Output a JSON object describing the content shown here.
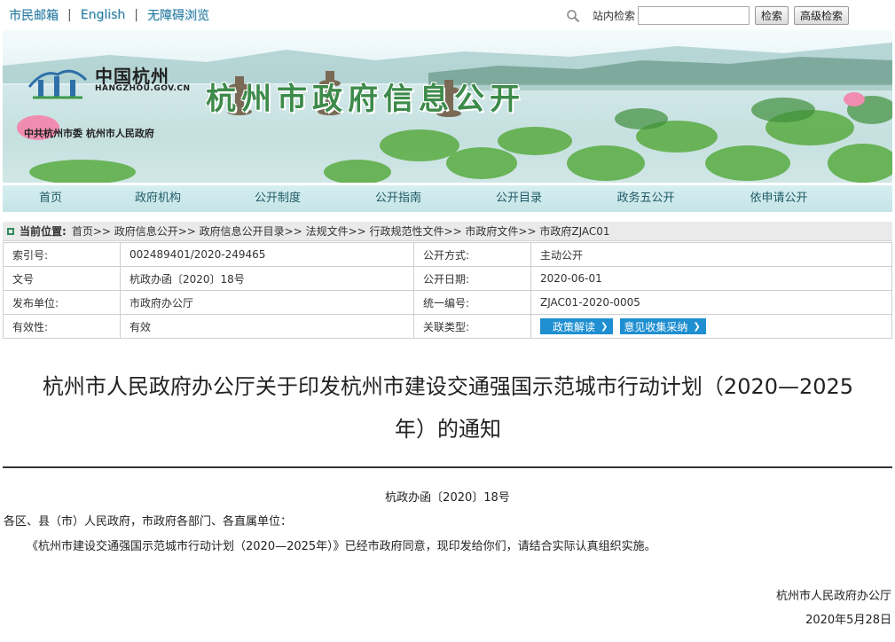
{
  "topbar": {
    "mailbox": "市民邮箱",
    "sep": "|",
    "english": "English",
    "accessible": "无障碍浏览",
    "search_label": "站内检索",
    "search_value": "",
    "search_button": "检索",
    "advanced_button": "高级检索"
  },
  "banner": {
    "logo_cn": "中国杭州",
    "logo_en": "HANGZHOU.GOV.CN",
    "logo_sub": "中共杭州市委  杭州市人民政府",
    "title": "杭州市政府信息公开"
  },
  "nav": [
    "首页",
    "政府机构",
    "公开制度",
    "公开指南",
    "公开目录",
    "政务五公开",
    "依申请公开"
  ],
  "breadcrumb": {
    "label": "当前位置:",
    "path": "首页>> 政府信息公开>> 政府信息公开目录>> 法规文件>> 行政规范性文件>> 市政府文件>> 市政府ZJAC01"
  },
  "meta": {
    "index_label": "索引号:",
    "index_value": "002489401/2020-249465",
    "method_label": "公开方式:",
    "method_value": "主动公开",
    "docnum_label": "文号",
    "docnum_value": "杭政办函〔2020〕18号",
    "date_label": "公开日期:",
    "date_value": "2020-06-01",
    "issuer_label": "发布单位:",
    "issuer_value": "市政府办公厅",
    "uid_label": "统一编号:",
    "uid_value": "ZJAC01-2020-0005",
    "validity_label": "有效性:",
    "validity_value": "有效",
    "related_label": "关联类型:",
    "related_btn1": "政策解读",
    "related_btn2": "意见收集采纳"
  },
  "document": {
    "title": "杭州市人民政府办公厅关于印发杭州市建设交通强国示范城市行动计划（2020—2025年）的通知",
    "number": "杭政办函〔2020〕18号",
    "addressee": "各区、县（市）人民政府，市政府各部门、各直属单位：",
    "body": "《杭州市建设交通强国示范城市行动计划（2020—2025年）》已经市政府同意，现印发给你们，请结合实际认真组织实施。",
    "signature": "杭州市人民政府办公厅",
    "date": "2020年5月28日"
  }
}
